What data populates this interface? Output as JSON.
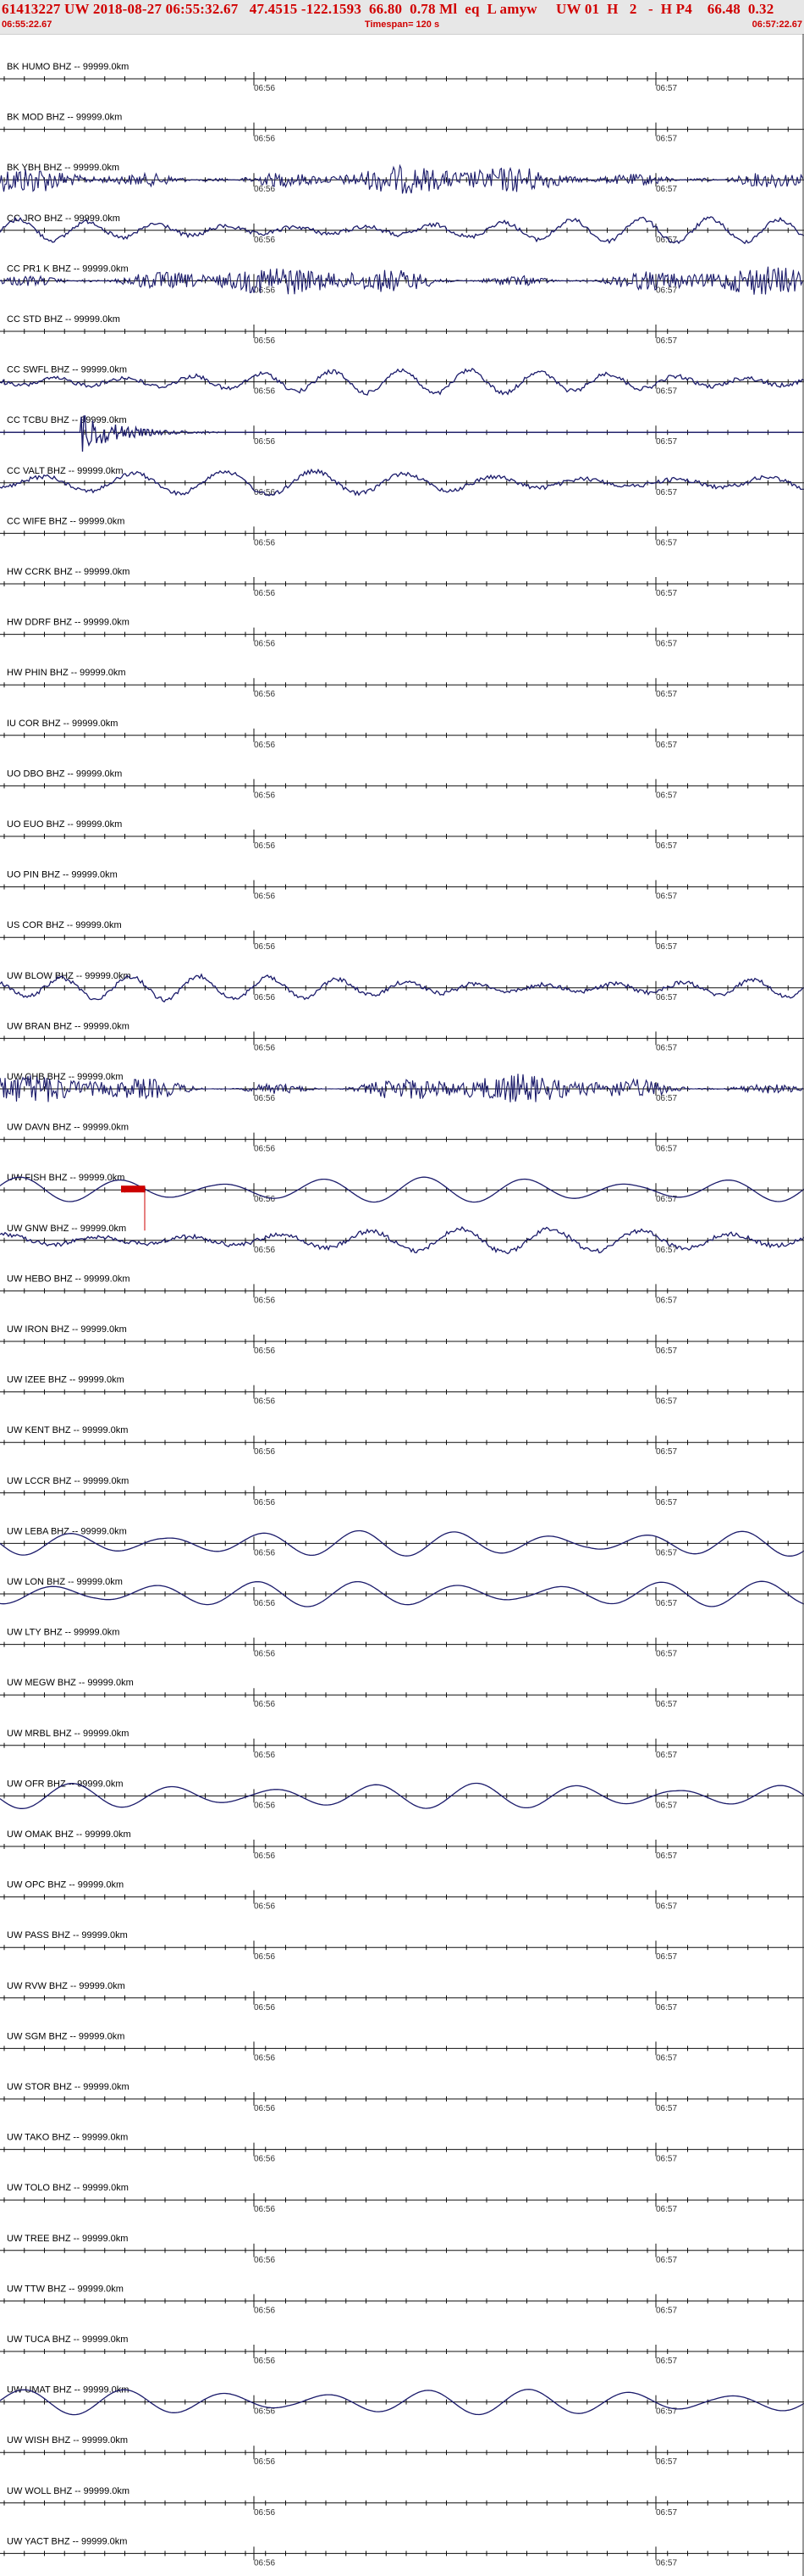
{
  "header": {
    "title": "61413227 UW 2018-08-27 06:55:32.67   47.4515 -122.1593  66.80  0.78 Ml  eq  L amyw     UW 01  H   2   -  H P4    66.48  0.32",
    "start_time": "06:55:22.67",
    "timespan": "Timespan= 120 s",
    "end_time": "06:57:22.67"
  },
  "time_ticks": [
    "06:56",
    "06:57"
  ],
  "colors": {
    "trace": "#1b1b6b",
    "baseline": "#111111",
    "pick": "#cc0000",
    "header_text": "#d10000"
  },
  "traces": [
    {
      "label": "BK HUMO BHZ -- 99999.0km",
      "style": "flat"
    },
    {
      "label": "BK MOD BHZ -- 99999.0km",
      "style": "flat"
    },
    {
      "label": "BK YBH BHZ -- 99999.0km",
      "style": "noisy"
    },
    {
      "label": "CC JRO BHZ -- 99999.0km",
      "style": "wave"
    },
    {
      "label": "CC PR1 K BHZ -- 99999.0km",
      "style": "noisy"
    },
    {
      "label": "CC STD BHZ -- 99999.0km",
      "style": "flat"
    },
    {
      "label": "CC SWFL BHZ -- 99999.0km",
      "style": "wave"
    },
    {
      "label": "CC TCBU BHZ -- 99999.0km",
      "style": "burst"
    },
    {
      "label": "CC VALT BHZ -- 99999.0km",
      "style": "wave"
    },
    {
      "label": "CC WIFE BHZ -- 99999.0km",
      "style": "flat"
    },
    {
      "label": "HW CCRK BHZ -- 99999.0km",
      "style": "flat"
    },
    {
      "label": "HW DDRF BHZ -- 99999.0km",
      "style": "flat"
    },
    {
      "label": "HW PHIN BHZ -- 99999.0km",
      "style": "flat"
    },
    {
      "label": "IU COR BHZ -- 99999.0km",
      "style": "flat"
    },
    {
      "label": "UO DBO BHZ -- 99999.0km",
      "style": "flat"
    },
    {
      "label": "UO EUO BHZ -- 99999.0km",
      "style": "flat"
    },
    {
      "label": "UO PIN BHZ -- 99999.0km",
      "style": "flat"
    },
    {
      "label": "US COR BHZ -- 99999.0km",
      "style": "flat"
    },
    {
      "label": "UW BLOW BHZ -- 99999.0km",
      "style": "wave"
    },
    {
      "label": "UW BRAN BHZ -- 99999.0km",
      "style": "flat"
    },
    {
      "label": "UW CHB BHZ -- 99999.0km",
      "style": "noisy"
    },
    {
      "label": "UW DAVN BHZ -- 99999.0km",
      "style": "flat"
    },
    {
      "label": "UW FISH BHZ -- 99999.0km",
      "style": "smooth",
      "pick": true
    },
    {
      "label": "UW GNW BHZ -- 99999.0km",
      "style": "wave"
    },
    {
      "label": "UW HEBO BHZ -- 99999.0km",
      "style": "flat"
    },
    {
      "label": "UW IRON BHZ -- 99999.0km",
      "style": "flat"
    },
    {
      "label": "UW IZEE BHZ -- 99999.0km",
      "style": "flat"
    },
    {
      "label": "UW KENT BHZ -- 99999.0km",
      "style": "flat"
    },
    {
      "label": "UW LCCR BHZ -- 99999.0km",
      "style": "flat"
    },
    {
      "label": "UW LEBA BHZ -- 99999.0km",
      "style": "smooth"
    },
    {
      "label": "UW LON BHZ -- 99999.0km",
      "style": "smooth"
    },
    {
      "label": "UW LTY BHZ -- 99999.0km",
      "style": "flat"
    },
    {
      "label": "UW MEGW BHZ -- 99999.0km",
      "style": "flat"
    },
    {
      "label": "UW MRBL BHZ -- 99999.0km",
      "style": "flat"
    },
    {
      "label": "UW OFR BHZ -- 99999.0km",
      "style": "smooth"
    },
    {
      "label": "UW OMAK BHZ -- 99999.0km",
      "style": "flat"
    },
    {
      "label": "UW OPC BHZ -- 99999.0km",
      "style": "flat"
    },
    {
      "label": "UW PASS BHZ -- 99999.0km",
      "style": "flat"
    },
    {
      "label": "UW RVW BHZ -- 99999.0km",
      "style": "flat"
    },
    {
      "label": "UW SGM BHZ -- 99999.0km",
      "style": "flat"
    },
    {
      "label": "UW STOR BHZ -- 99999.0km",
      "style": "flat"
    },
    {
      "label": "UW TAKO BHZ -- 99999.0km",
      "style": "flat"
    },
    {
      "label": "UW TOLO BHZ -- 99999.0km",
      "style": "flat"
    },
    {
      "label": "UW TREE BHZ -- 99999.0km",
      "style": "flat"
    },
    {
      "label": "UW TTW BHZ -- 99999.0km",
      "style": "flat"
    },
    {
      "label": "UW TUCA BHZ -- 99999.0km",
      "style": "flat"
    },
    {
      "label": "UW UMAT BHZ -- 99999.0km",
      "style": "smooth"
    },
    {
      "label": "UW WISH BHZ -- 99999.0km",
      "style": "flat"
    },
    {
      "label": "UW WOLL BHZ -- 99999.0km",
      "style": "flat"
    },
    {
      "label": "UW YACT BHZ -- 99999.0km",
      "style": "flat"
    }
  ]
}
